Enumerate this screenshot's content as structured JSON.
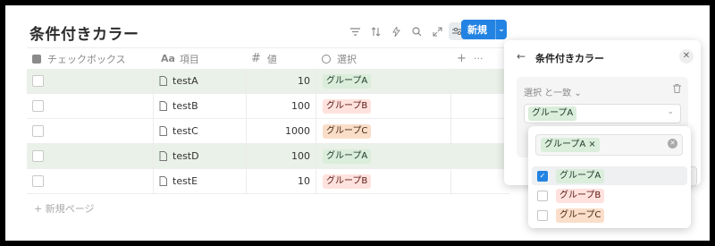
{
  "title": "条件付きカラー",
  "toolbar": {
    "icons": [
      "filter-icon",
      "sort-icon",
      "lightning-icon",
      "search-icon",
      "expand-icon",
      "settings-icon"
    ],
    "new_label": "新規"
  },
  "columns": {
    "checkbox": "チェックボックス",
    "item_icon": "Aa",
    "item": "項目",
    "value_icon": "#",
    "value": "値",
    "select": "選択",
    "add": "+",
    "more": "···"
  },
  "rows": [
    {
      "name": "testA",
      "value": "10",
      "tag": "グループA",
      "tag_class": "a",
      "highlight": true
    },
    {
      "name": "testB",
      "value": "100",
      "tag": "グループB",
      "tag_class": "b",
      "highlight": false
    },
    {
      "name": "testC",
      "value": "1000",
      "tag": "グループC",
      "tag_class": "c",
      "highlight": false
    },
    {
      "name": "testD",
      "value": "100",
      "tag": "グループA",
      "tag_class": "a",
      "highlight": true
    },
    {
      "name": "testE",
      "value": "10",
      "tag": "グループB",
      "tag_class": "b",
      "highlight": false
    }
  ],
  "new_page": "+ 新規ページ",
  "panel": {
    "title": "条件付きカラー",
    "rule_label": "選択 と一致 ⌄",
    "selected_value": "グループA"
  },
  "dropdown": {
    "search_tag": "グループA ×",
    "options": [
      {
        "label": "グループA",
        "checked": true,
        "tag_class": "a"
      },
      {
        "label": "グループB",
        "checked": false,
        "tag_class": "b"
      },
      {
        "label": "グループC",
        "checked": false,
        "tag_class": "c"
      }
    ]
  },
  "colors": {
    "accent": "#2383e2",
    "highlight_row": "#eaf1e8",
    "tag_a": "#dbeddb",
    "tag_b": "#ffe2dd",
    "tag_c": "#fadec9"
  }
}
